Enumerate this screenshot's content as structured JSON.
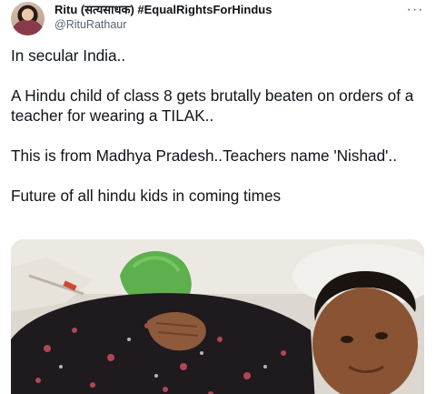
{
  "user": {
    "display_name": "Ritu (सत्यसाधक) #EqualRightsForHindus",
    "handle": "@RituRathaur"
  },
  "more_label": "···",
  "tweet": {
    "paragraphs": [
      "In secular India..",
      "A Hindu child of class 8 gets brutally beaten on orders of a teacher for wearing a TILAK..",
      "This is from Madhya Pradesh..Teachers name 'Nishad'..",
      "Future of all hindu kids in coming times"
    ]
  }
}
